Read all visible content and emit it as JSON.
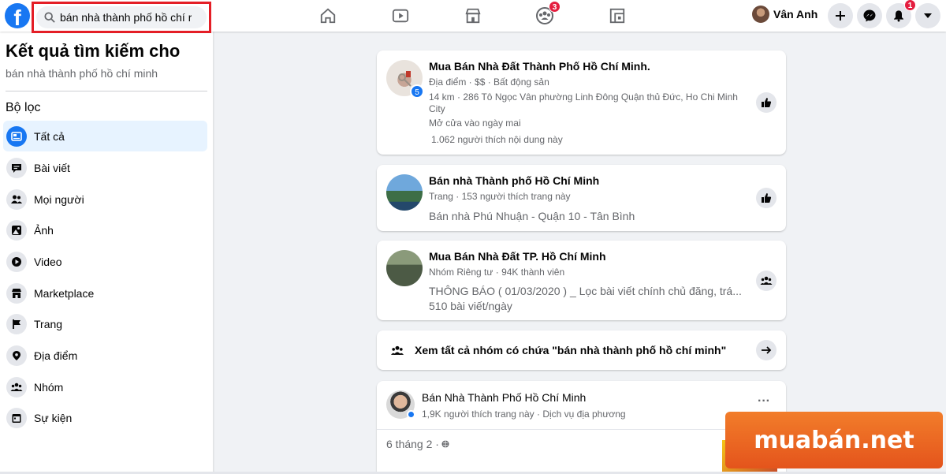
{
  "topbar": {
    "logo_letter": "f",
    "search_value": "bán nhà thành phố hồ chí r",
    "groups_badge": "3",
    "user_name": "Vân Anh",
    "notifications_badge": "1"
  },
  "sidebar": {
    "title": "Kết quả tìm kiếm cho",
    "query": "bán nhà thành phố hồ chí minh",
    "filter_heading": "Bộ lọc",
    "items": [
      {
        "label": "Tất cả",
        "icon": "all-results-icon"
      },
      {
        "label": "Bài viết",
        "icon": "posts-icon"
      },
      {
        "label": "Mọi người",
        "icon": "people-icon"
      },
      {
        "label": "Ảnh",
        "icon": "photos-icon"
      },
      {
        "label": "Video",
        "icon": "video-icon"
      },
      {
        "label": "Marketplace",
        "icon": "marketplace-icon"
      },
      {
        "label": "Trang",
        "icon": "flag-icon"
      },
      {
        "label": "Địa điểm",
        "icon": "location-pin-icon"
      },
      {
        "label": "Nhóm",
        "icon": "groups-icon"
      },
      {
        "label": "Sự kiện",
        "icon": "calendar-icon"
      }
    ]
  },
  "results": {
    "place": {
      "title": "Mua Bán Nhà Đất Thành Phố Hồ Chí Minh.",
      "meta": "Địa điểm · $$ · Bất động sản",
      "address_line1": "14 km · 286 Tô Ngọc Vân phường Linh Đông Quận thủ Đức, Ho Chi Minh",
      "address_line2": "City",
      "hours": "Mở cửa vào ngày mai",
      "likes": "1.062 người thích nội dung này",
      "avatar_badge": "5"
    },
    "page": {
      "title": "Bán nhà Thành phố Hồ Chí Minh",
      "meta": "Trang · 153 người thích trang này",
      "desc": "Bán nhà Phú Nhuận - Quận 10 - Tân Bình"
    },
    "group": {
      "title": "Mua Bán Nhà Đất TP. Hồ Chí Minh",
      "meta": "Nhóm Riêng tư · 94K thành viên",
      "desc": "THÔNG BÁO ( 01/03/2020 ) _ Lọc bài viết chính chủ đăng, trá...",
      "posts_per_day": "510 bài viết/ngày"
    },
    "see_all_groups": "Xem tất cả nhóm có chứa \"bán nhà thành phố hồ chí minh\"",
    "post": {
      "author": "Bán Nhà Thành Phố Hồ Chí Minh",
      "meta": "1,9K người thích trang này · Dịch vụ địa phương",
      "more": "···",
      "date": "6 tháng 2 ·"
    }
  },
  "watermark": "muabán.net",
  "colors": {
    "brand_blue": "#1877f2",
    "badge_red": "#e41e3f",
    "highlight_red": "#e41e26",
    "watermark_orange": "#f27d2a"
  }
}
